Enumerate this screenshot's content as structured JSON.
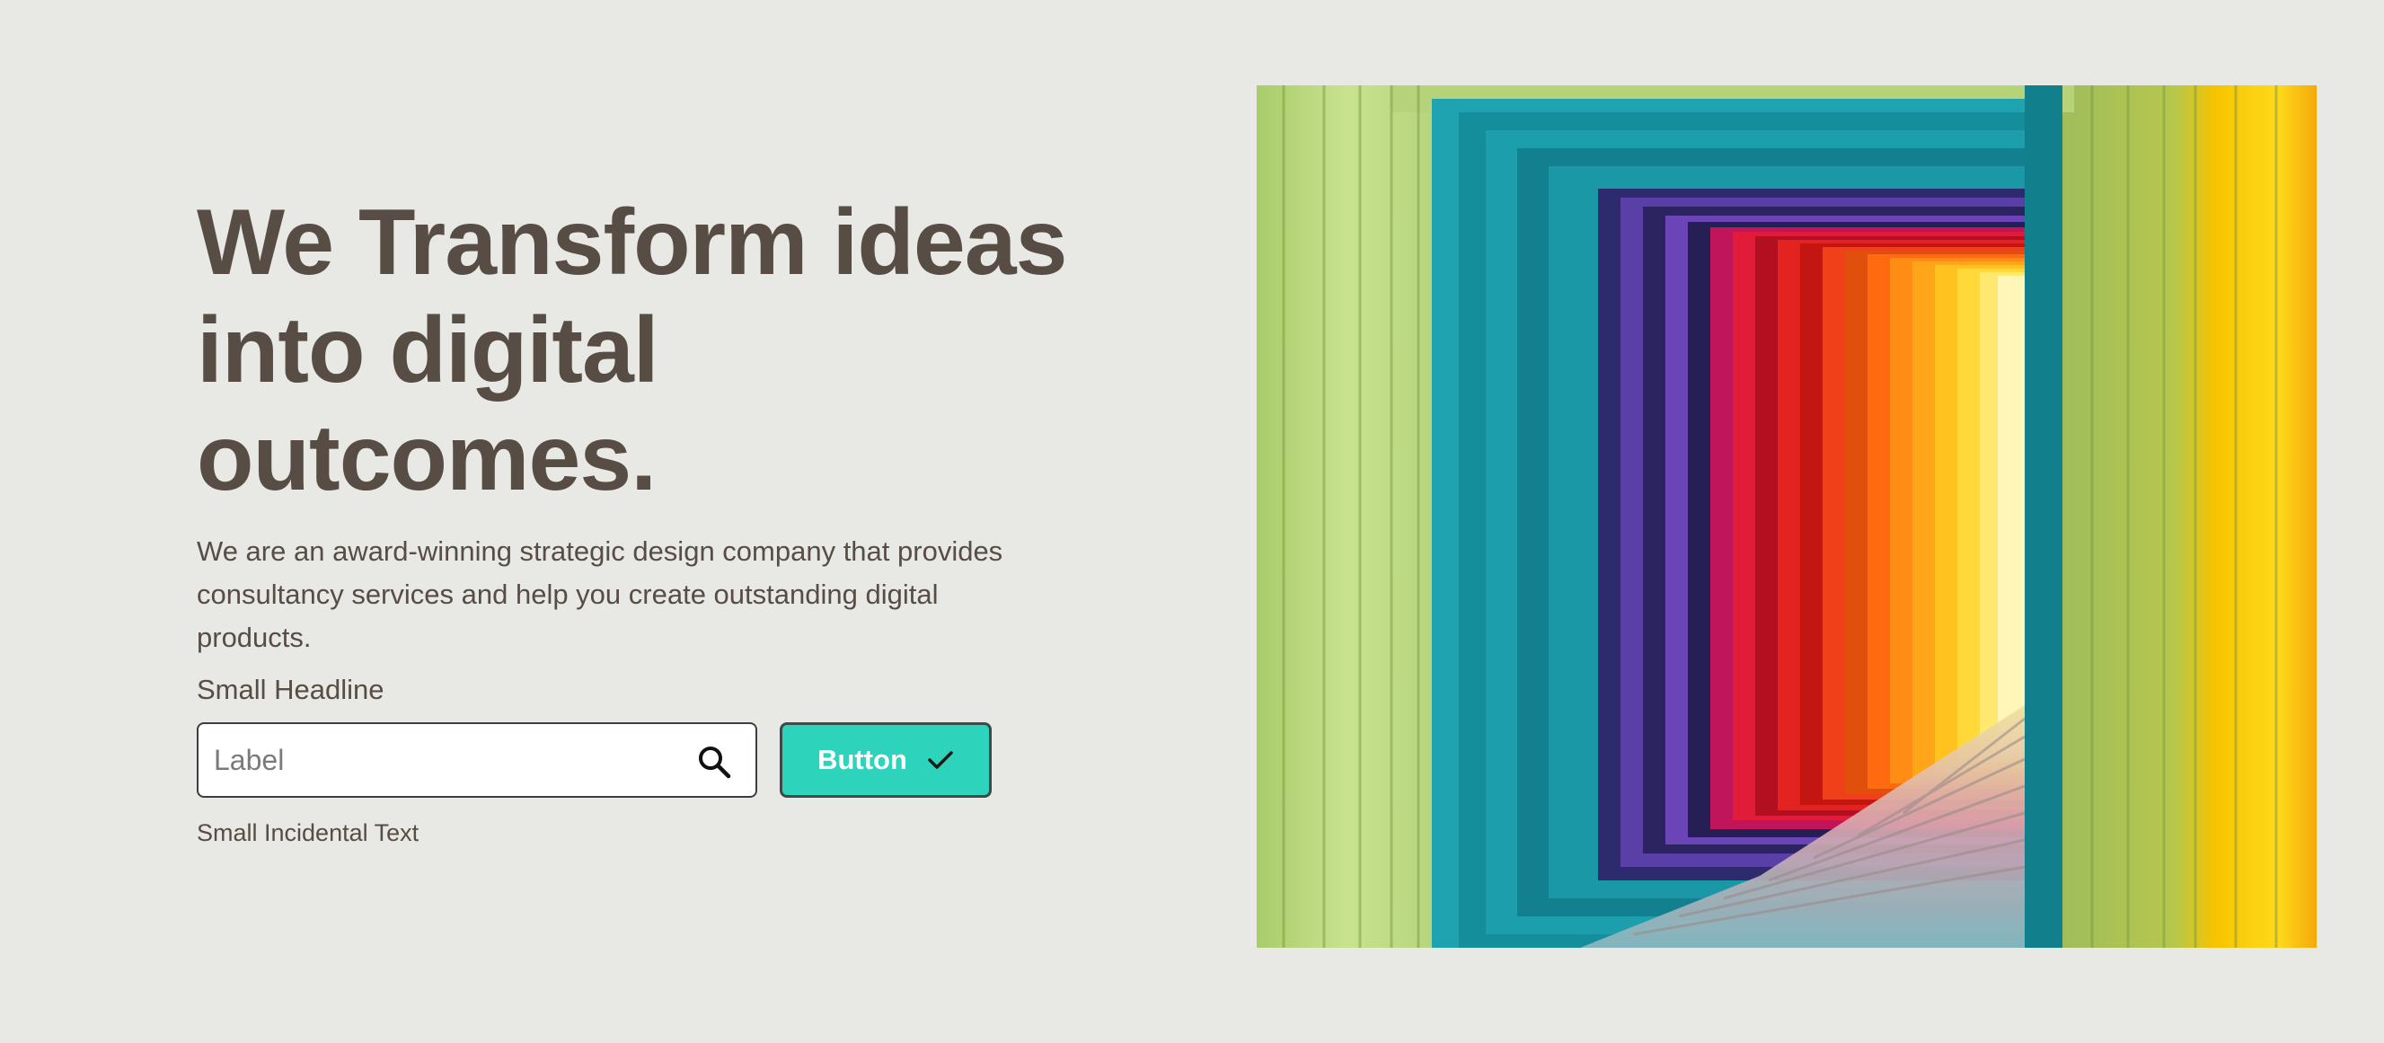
{
  "hero": {
    "headline_line1": "We Transform ideas",
    "headline_line2": "into digital",
    "headline_line3": "outcomes.",
    "description": "We are an award-winning strategic design company that provides consultancy services and help you create outstanding digital products.",
    "small_headline": "Small Headline",
    "incidental_text": "Small Incidental Text"
  },
  "search": {
    "placeholder": "Label",
    "value": "",
    "icon": "search-icon"
  },
  "button": {
    "label": "Button",
    "icon": "check-icon"
  },
  "image": {
    "description_icon": "rainbow-corridor-image"
  },
  "colors": {
    "background": "#e8e8e4",
    "text": "#574d45",
    "accent": "#2dd4bb"
  }
}
